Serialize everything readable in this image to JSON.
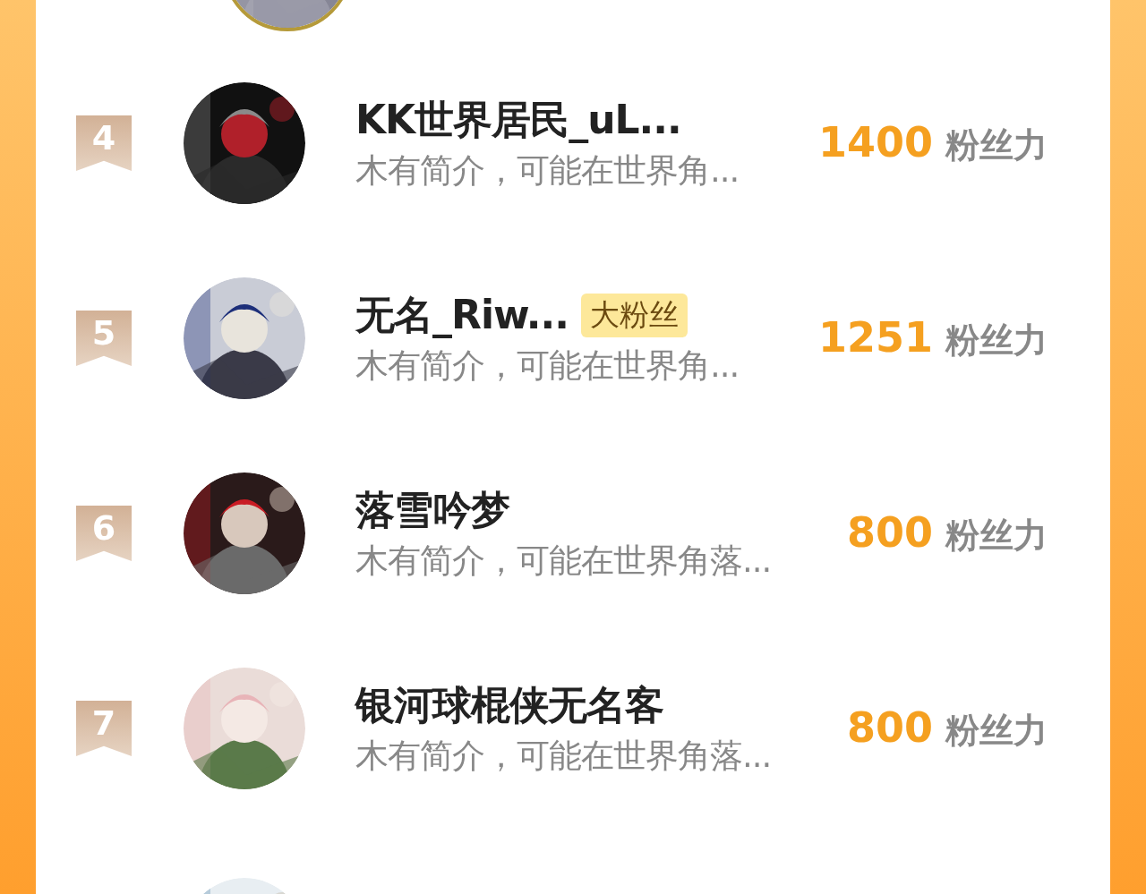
{
  "rows": [
    {
      "rank": "4",
      "name": "KK世界居民_uL...",
      "bio": "木有简介，可能在世界角...",
      "score": "1400",
      "score_unit": "粉丝力"
    },
    {
      "rank": "5",
      "name": "无名_Riw...",
      "badge": "大粉丝",
      "bio": "木有简介，可能在世界角...",
      "score": "1251",
      "score_unit": "粉丝力"
    },
    {
      "rank": "6",
      "name": "落雪吟梦",
      "bio": "木有简介，可能在世界角落...",
      "score": "800",
      "score_unit": "粉丝力"
    },
    {
      "rank": "7",
      "name": "银河球棍侠无名客",
      "bio": "木有简介，可能在世界角落...",
      "score": "800",
      "score_unit": "粉丝力"
    }
  ]
}
